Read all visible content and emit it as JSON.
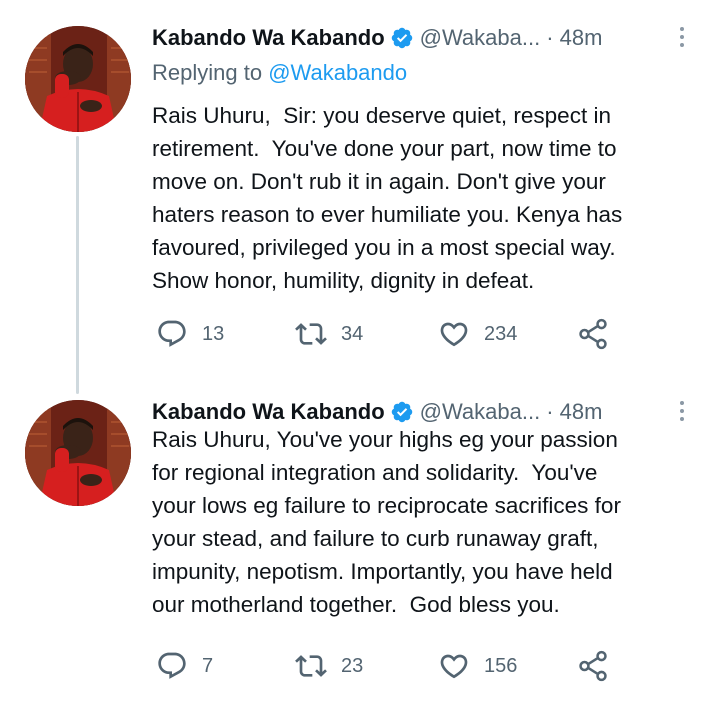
{
  "tweets": [
    {
      "author_name": "Kabando Wa Kabando",
      "handle": "@Wakaba...",
      "time": "· 48m",
      "replying_prefix": "Replying to ",
      "replying_to": "@Wakabando",
      "text": "Rais Uhuru,  Sir: you deserve quiet, respect in\nretirement.  You've done your part, now time to\nmove on. Don't rub it in again. Don't give your\nhaters reason to ever humiliate you. Kenya has\nfavoured, privileged you in a most special way.\nShow honor, humility, dignity in defeat.",
      "replies": "13",
      "retweets": "34",
      "likes": "234"
    },
    {
      "author_name": "Kabando Wa Kabando",
      "handle": "@Wakaba...",
      "time": "· 48m",
      "text": "Rais Uhuru, You've your highs eg your passion\nfor regional integration and solidarity.  You've\nyour lows eg failure to reciprocate sacrifices for\nyour stead, and failure to curb runaway graft,\nimpunity, nepotism. Importantly, you have held\nour motherland together.  God bless you.",
      "replies": "7",
      "retweets": "23",
      "likes": "156"
    }
  ],
  "icons": {
    "verified": "verified-badge-icon",
    "more": "more-icon",
    "reply": "reply-icon",
    "retweet": "retweet-icon",
    "like": "heart-icon",
    "share": "share-icon"
  },
  "colors": {
    "accent": "#1d9bf0",
    "secondary_text": "#536471",
    "primary_text": "#0f1419",
    "icon": "#536471",
    "thread_line": "#cfd9de"
  }
}
